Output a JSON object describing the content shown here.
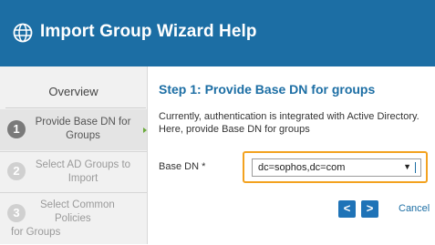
{
  "header": {
    "title": "Import Group Wizard Help"
  },
  "sidebar": {
    "overview": "Overview",
    "steps": [
      {
        "num": "1",
        "label": "Provide Base DN for Groups"
      },
      {
        "num": "2",
        "label": "Select AD Groups to Import"
      },
      {
        "num": "3",
        "label_line1": "Select Common",
        "label_line2": "Policies",
        "label_line3": "for Groups"
      }
    ]
  },
  "main": {
    "step_title": "Step 1: Provide Base DN for groups",
    "description": "Currently, authentication is integrated with Active Directory. Here, provide Base DN for groups",
    "base_dn_label": "Base DN *",
    "base_dn_value": "dc=sophos,dc=com",
    "prev_glyph": "<",
    "next_glyph": ">",
    "cancel_label": "Cancel"
  },
  "colors": {
    "header_bg": "#1c6ea4",
    "accent": "#1f73b7",
    "highlight": "#f3a21f"
  }
}
